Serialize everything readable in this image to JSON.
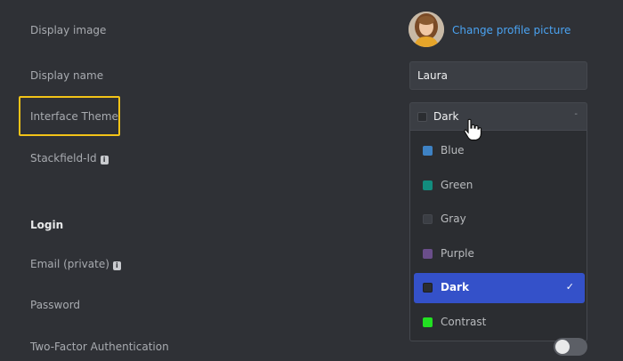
{
  "profile": {
    "display_image_label": "Display image",
    "change_picture_link": "Change profile picture",
    "display_name_label": "Display name",
    "display_name_value": "Laura",
    "interface_theme_label": "Interface Theme",
    "stackfield_id_label": "Stackfield-Id",
    "info_icon_glyph": "i"
  },
  "theme_select": {
    "selected": "Dark",
    "selected_color": "#2b2d31",
    "options": [
      {
        "label": "Blue",
        "color": "#3e82c4"
      },
      {
        "label": "Green",
        "color": "#128c7e"
      },
      {
        "label": "Gray",
        "color": "#3b3e44"
      },
      {
        "label": "Purple",
        "color": "#6a4e8a"
      },
      {
        "label": "Dark",
        "color": "#2b2d31",
        "selected": true
      },
      {
        "label": "Contrast",
        "color": "#22e022"
      }
    ],
    "check_glyph": "✓"
  },
  "login": {
    "heading": "Login",
    "email_label": "Email (private)",
    "password_label": "Password",
    "two_factor_label": "Two-Factor Authentication",
    "two_factor_enabled": false
  },
  "colors": {
    "background": "#2f3136",
    "link": "#4aa3f2",
    "highlight": "#f2c318",
    "selected_option": "#3451c9"
  }
}
